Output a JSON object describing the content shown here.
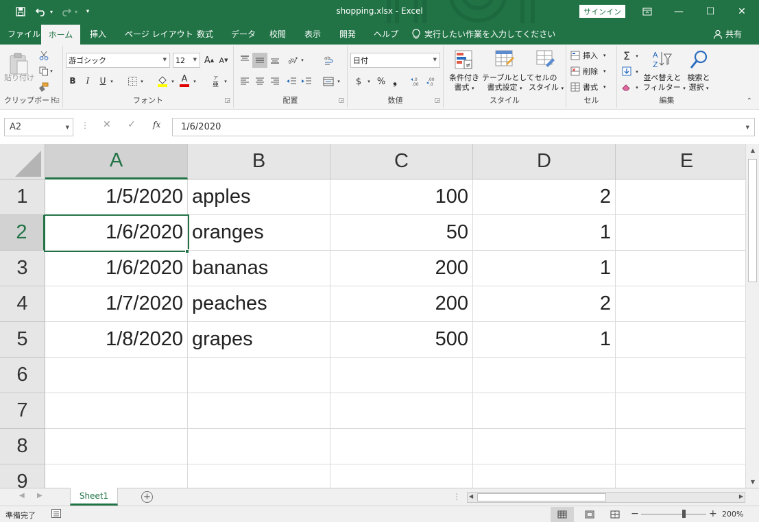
{
  "window": {
    "title": "shopping.xlsx  -  Excel",
    "signin_label": "サインイン",
    "minimize": "—",
    "restore": "☐",
    "close": "✕",
    "ribbon_display_icon": "ribbon-display-options-icon"
  },
  "quick_access": {
    "save_icon": "save-icon",
    "undo_icon": "undo-icon",
    "redo_icon": "redo-icon",
    "customize": "▾"
  },
  "tabs": [
    {
      "label": "ファイル"
    },
    {
      "label": "ホーム",
      "active": true
    },
    {
      "label": "挿入"
    },
    {
      "label": "ページ レイアウト"
    },
    {
      "label": "数式"
    },
    {
      "label": "データ"
    },
    {
      "label": "校閲"
    },
    {
      "label": "表示"
    },
    {
      "label": "開発"
    },
    {
      "label": "ヘルプ"
    }
  ],
  "tell_me": "実行したい作業を入力してください",
  "share": "共有",
  "ribbon": {
    "clipboard": {
      "label": "クリップボード",
      "paste": "貼り付け"
    },
    "font": {
      "label": "フォント",
      "font_name": "游ゴシック",
      "font_size": "12",
      "grow": "A",
      "shrink": "A",
      "bold": "B",
      "italic": "I",
      "underline": "U",
      "font_color_letter": "A"
    },
    "alignment": {
      "label": "配置"
    },
    "number": {
      "label": "数値",
      "format": "日付",
      "currency": "$",
      "percent": "%",
      "comma": "❟"
    },
    "styles": {
      "label": "スタイル",
      "conditional": [
        "条件付き",
        "書式"
      ],
      "table": [
        "テーブルとして",
        "書式設定"
      ],
      "cell_styles": [
        "セルの",
        "スタイル"
      ]
    },
    "cells": {
      "label": "セル",
      "insert": "挿入",
      "delete": "削除",
      "format": "書式"
    },
    "editing": {
      "label": "編集",
      "sort_filter": [
        "並べ替えと",
        "フィルター"
      ],
      "find_select": [
        "検索と",
        "選択"
      ]
    }
  },
  "formula_bar": {
    "name_box": "A2",
    "cancel": "✕",
    "enter": "✓",
    "fx": "fx",
    "value": "1/6/2020"
  },
  "sheet": {
    "columns": [
      "A",
      "B",
      "C",
      "D",
      "E"
    ],
    "selected_column": "A",
    "selected_row": "2",
    "row_numbers": [
      "1",
      "2",
      "3",
      "4",
      "5",
      "6",
      "7",
      "8",
      "9"
    ],
    "rows": [
      {
        "date": "1/5/2020",
        "item": "apples",
        "price": "100",
        "qty": "2"
      },
      {
        "date": "1/6/2020",
        "item": "oranges",
        "price": "50",
        "qty": "1"
      },
      {
        "date": "1/6/2020",
        "item": "bananas",
        "price": "200",
        "qty": "1"
      },
      {
        "date": "1/7/2020",
        "item": "peaches",
        "price": "200",
        "qty": "2"
      },
      {
        "date": "1/8/2020",
        "item": "grapes",
        "price": "500",
        "qty": "1"
      }
    ]
  },
  "sheet_tabs": {
    "tabs": [
      "Sheet1"
    ],
    "add": "+"
  },
  "status": {
    "text": "準備完了",
    "zoom": "200%",
    "zoom_minus": "−",
    "zoom_plus": "+",
    "zoom_level_percent": 200
  },
  "colors": {
    "accent": "#217346",
    "header_bg": "#e6e6e6",
    "ribbon_bg": "#f3f3f3"
  }
}
